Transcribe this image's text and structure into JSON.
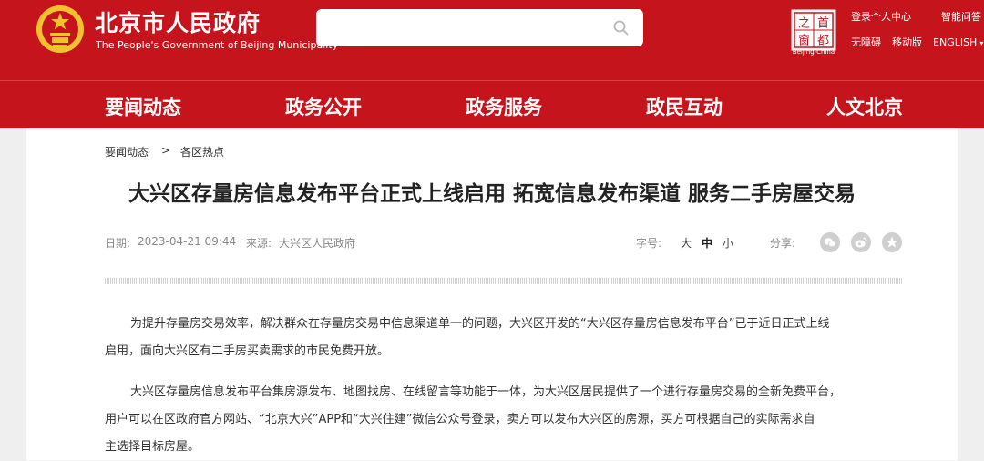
{
  "header": {
    "site_name": "北京市人民政府",
    "site_name_en": "The People's Government of Beijing Municipality",
    "search": {
      "value": "",
      "placeholder": ""
    },
    "seal_caption": "Beijing-China",
    "seal_chars": [
      "首",
      "之",
      "都",
      "窗"
    ],
    "utility_links": [
      {
        "label": "登录个人中心"
      },
      {
        "label": "智能问答"
      },
      {
        "label": "无障碍"
      },
      {
        "label": "移动版"
      },
      {
        "label": "ENGLISH"
      }
    ]
  },
  "nav": {
    "items": [
      {
        "label": "要闻动态"
      },
      {
        "label": "政务公开"
      },
      {
        "label": "政务服务"
      },
      {
        "label": "政民互动"
      },
      {
        "label": "人文北京"
      }
    ]
  },
  "breadcrumb": {
    "items": [
      "要闻动态",
      "各区热点"
    ],
    "separator": ">"
  },
  "article": {
    "title": "大兴区存量房信息发布平台正式上线启用 拓宽信息发布渠道 服务二手房屋交易",
    "date_label": "日期:",
    "date": "2023-04-21 09:44",
    "source_label": "来源:",
    "source": "大兴区人民政府",
    "font_size_label": "字号:",
    "font_sizes": [
      "大",
      "中",
      "小"
    ],
    "font_size_active": "中",
    "share_label": "分享:",
    "share_icons": [
      "wechat-icon",
      "weibo-icon",
      "favorite-icon"
    ],
    "paragraphs": [
      {
        "lines": [
          "为提升存量房交易效率，解决群众在存量房交易中信息渠道单一的问题，大兴区开发的“大兴区存量房信息发布平台”已于近日正式上线",
          "启用，面向大兴区有二手房买卖需求的市民免费开放。"
        ]
      },
      {
        "lines": [
          "大兴区存量房信息发布平台集房源发布、地图找房、在线留言等功能于一体，为大兴区居民提供了一个进行存量房交易的全新免费平台，",
          "用户可以在区政府官方网站、“北京大兴”APP和“大兴住建”微信公众号登录，卖方可以发布大兴区的房源，买方可根据自己的实际需求自",
          "主选择目标房屋。"
        ]
      }
    ]
  },
  "colors": {
    "brand_red": "#c5141c",
    "page_background": "#efefef",
    "content_background": "#ffffff",
    "emblem_gold": "#f2c12e"
  }
}
